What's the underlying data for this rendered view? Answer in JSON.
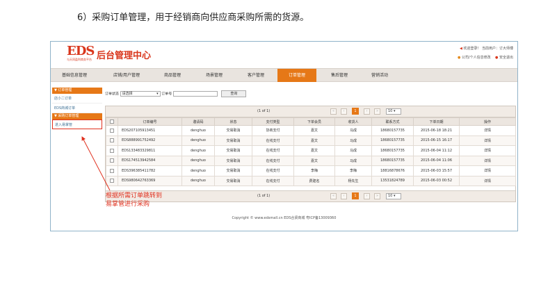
{
  "heading": "6）采购订单管理，用于经销商向供应商采购所需的货源。",
  "header": {
    "logo_text": "EDS",
    "logo_badge": "百货商城",
    "logo_sub": "与天同盈利商务平台",
    "title": "后台管理中心",
    "welcome": "欢迎登录！ 当前用户：订大师傅",
    "links": [
      "公司/个人信息修改",
      "安全退出"
    ]
  },
  "nav": {
    "items": [
      "基础信息管理",
      "店铺/用户管理",
      "商品管理",
      "场景管理",
      "客户管理",
      "订单管理",
      "售后管理",
      "营销活动"
    ],
    "active": "订单管理"
  },
  "sidebar": {
    "groups": [
      {
        "title": "▼ 订单管理",
        "items": [
          "店小二订单",
          "EDS商城订单"
        ]
      },
      {
        "title": "▼ 采购订单管理",
        "items": [
          "进入易掌管"
        ]
      }
    ]
  },
  "search": {
    "status_label": "订单状态",
    "status_value": "请选择",
    "order_no_label": "订单号",
    "query_button": "查询"
  },
  "pager": {
    "info": "(1 of 1)",
    "current_page": "1",
    "page_size": "10"
  },
  "table": {
    "columns": [
      "",
      "订单编号",
      "邀请码",
      "状态",
      "支付类型",
      "下单会员",
      "收货人",
      "联系方式",
      "下单日期",
      "操作"
    ],
    "rows": [
      [
        "",
        "EDS207105913451",
        "denghuo",
        "交易取消",
        "协商支付",
        "嘉文",
        "马成",
        "18680157735",
        "2015-06-18 18:21",
        "详情"
      ],
      [
        "",
        "EDS888991752492",
        "denghuo",
        "交易取消",
        "在线支付",
        "嘉文",
        "马成",
        "18680157735",
        "2015-06-15 16:17",
        "详情"
      ],
      [
        "",
        "EDS133483329811",
        "denghuo",
        "交易取消",
        "在线支付",
        "嘉文",
        "马成",
        "18680157735",
        "2015-06-04 11:12",
        "详情"
      ],
      [
        "",
        "EDS174513942584",
        "denghuo",
        "交易取消",
        "在线支付",
        "嘉文",
        "马成",
        "18680157735",
        "2015-06-04 11:06",
        "详情"
      ],
      [
        "",
        "EDS396385411782",
        "denghuo",
        "交易取消",
        "在线支付",
        "李梅",
        "李梅",
        "18816878676",
        "2015-06-03 15:57",
        "详情"
      ],
      [
        "",
        "EDS980642763369",
        "denghuo",
        "交易取消",
        "在线支付",
        "费建名",
        "杨先生",
        "13531824789",
        "2015-06-03 00:52",
        "详情"
      ]
    ]
  },
  "footer": "Copyright © www.edsmall.cn EDS合贤商城 粤ICP备13009360",
  "annotation": {
    "line1": "根据所需订单跳转到",
    "line2": "易掌管进行采购"
  },
  "colors": {
    "accent": "#e67817",
    "brand": "#d9361c",
    "annotation": "#e0301e"
  }
}
